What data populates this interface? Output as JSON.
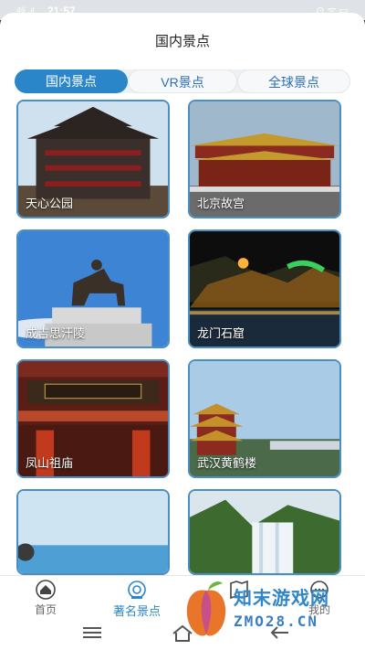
{
  "status": {
    "time": "21:57",
    "signal": "46 .ıl",
    "icons": "⊙ ᯤ ▭"
  },
  "header": {
    "title": "国内景点"
  },
  "tabs": [
    {
      "label": "国内景点",
      "active": true
    },
    {
      "label": "VR景点",
      "active": false
    },
    {
      "label": "全球景点",
      "active": false
    }
  ],
  "spots": [
    {
      "label": "天心公园"
    },
    {
      "label": "北京故宫"
    },
    {
      "label": "成吉思汗陵"
    },
    {
      "label": "龙门石窟"
    },
    {
      "label": "凤山祖庙"
    },
    {
      "label": "武汉黄鹤楼"
    },
    {
      "label": ""
    },
    {
      "label": ""
    }
  ],
  "nav": [
    {
      "label": "首页",
      "icon": "home-icon",
      "active": false
    },
    {
      "label": "著名景点",
      "icon": "camera-icon",
      "active": true
    },
    {
      "label": "",
      "icon": "map-icon",
      "active": false
    },
    {
      "label": "我的",
      "icon": "message-icon",
      "active": false
    }
  ],
  "watermark": {
    "text": "知末游戏网",
    "url": "ZMO28.CN"
  },
  "colors": {
    "accent": "#2b86c9",
    "card_border": "#4a8fc4"
  }
}
